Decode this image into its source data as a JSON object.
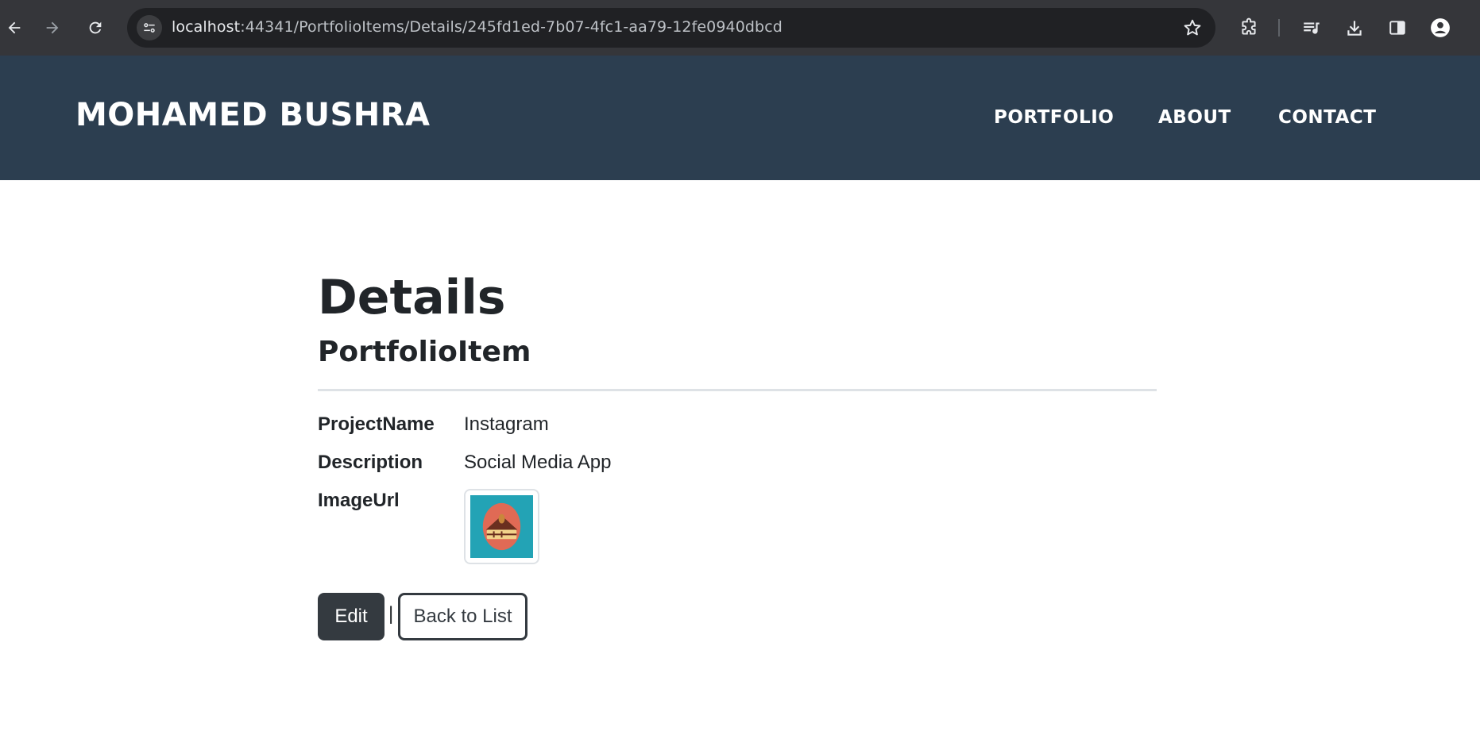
{
  "browser": {
    "url_host": "localhost",
    "url_rest": ":44341/PortfolioItems/Details/245fd1ed-7b07-4fc1-aa79-12fe0940dbcd",
    "icons": [
      "back-arrow-icon",
      "forward-arrow-icon",
      "reload-icon",
      "site-info-icon",
      "bookmark-star-icon",
      "extensions-icon",
      "media-queue-icon",
      "download-icon",
      "side-panel-icon",
      "profile-icon"
    ]
  },
  "header": {
    "brand": "MOHAMED BUSHRA",
    "nav": [
      "PORTFOLIO",
      "ABOUT",
      "CONTACT"
    ],
    "background": "#2c3e50"
  },
  "main": {
    "title": "Details",
    "subtitle": "PortfolioItem",
    "fields": [
      {
        "label": "ProjectName",
        "value": "Instagram"
      },
      {
        "label": "Description",
        "value": "Social Media App"
      },
      {
        "label": "ImageUrl",
        "value": ""
      }
    ],
    "image_icon": "cake-slice-image",
    "edit_label": "Edit",
    "separator": "|",
    "back_label": "Back to List",
    "button_color": "#343a40"
  }
}
